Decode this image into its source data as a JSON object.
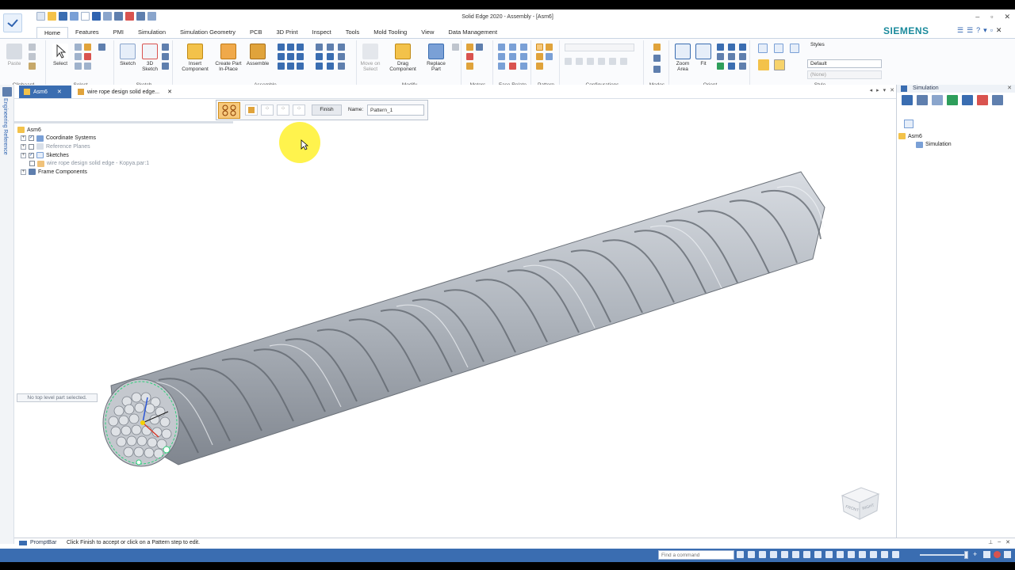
{
  "window": {
    "title": "Solid Edge 2020 - Assembly - [Asm6]",
    "brand": "SIEMENS",
    "controls": [
      "–",
      "▫",
      "✕"
    ]
  },
  "ribbon_tabs": [
    "Home",
    "Features",
    "PMI",
    "Simulation",
    "Simulation Geometry",
    "PCB",
    "3D Print",
    "Inspect",
    "Tools",
    "Mold Tooling",
    "View",
    "Data Management"
  ],
  "ribbon": {
    "clipboard": {
      "paste": "Paste",
      "label": "Clipboard"
    },
    "select": {
      "select": "Select",
      "label": "Select"
    },
    "sketch": {
      "sketch": "Sketch",
      "sketch3d": "3D Sketch",
      "label": "Sketch"
    },
    "assemble": {
      "insert": "Insert Component",
      "create": "Create Part In-Place",
      "assemble": "Assemble",
      "label": "Assemble"
    },
    "modify": {
      "move": "Move on Select",
      "drag": "Drag Component",
      "replace": "Replace Part",
      "label": "Modify"
    },
    "motors": {
      "label": "Motors"
    },
    "face_relate": {
      "label": "Face Relate"
    },
    "pattern": {
      "label": "Pattern"
    },
    "configurations": {
      "label": "Configurations"
    },
    "modes": {
      "label": "Modes"
    },
    "orient": {
      "zoom": "Zoom Area",
      "fit": "Fit",
      "label": "Orient"
    },
    "style": {
      "styles": "Styles",
      "selected": "Default",
      "secondary": "(None)",
      "label": "Style"
    }
  },
  "doc_tabs": [
    {
      "label": "Asm6",
      "active": true
    },
    {
      "label": "wire rope design solid edge...",
      "active": false
    }
  ],
  "left_strip_label": "Engineering Reference",
  "command_bar": {
    "finish": "Finish",
    "name_label": "Name:",
    "name_value": "Pattern_1"
  },
  "tree": [
    {
      "label": "Asm6",
      "level": 0,
      "grey": false
    },
    {
      "label": "Coordinate Systems",
      "level": 1,
      "grey": false,
      "checked": true
    },
    {
      "label": "Reference Planes",
      "level": 1,
      "grey": true,
      "checked": false
    },
    {
      "label": "Sketches",
      "level": 1,
      "grey": false,
      "checked": true
    },
    {
      "label": "wire rope design solid edge - Kopya.par:1",
      "level": 1,
      "grey": true,
      "checked": false
    },
    {
      "label": "Frame Components",
      "level": 1,
      "grey": false
    }
  ],
  "viewport_status": "No top level part selected.",
  "view_cube": {
    "front": "FRONT",
    "right": "RIGHT"
  },
  "right_panel": {
    "title": "Simulation",
    "tree_root": "Asm6",
    "tree_child": "Simulation"
  },
  "prompt_bar": {
    "label": "PromptBar",
    "message": "Click Finish to accept or click on a Pattern step to edit."
  },
  "status_bar": {
    "find_placeholder": "Find a command"
  },
  "colors": {
    "accent": "#3a6db1",
    "brand": "#1a8a9c",
    "rope": "#b9bec6",
    "highlight": "#f7c97c"
  }
}
